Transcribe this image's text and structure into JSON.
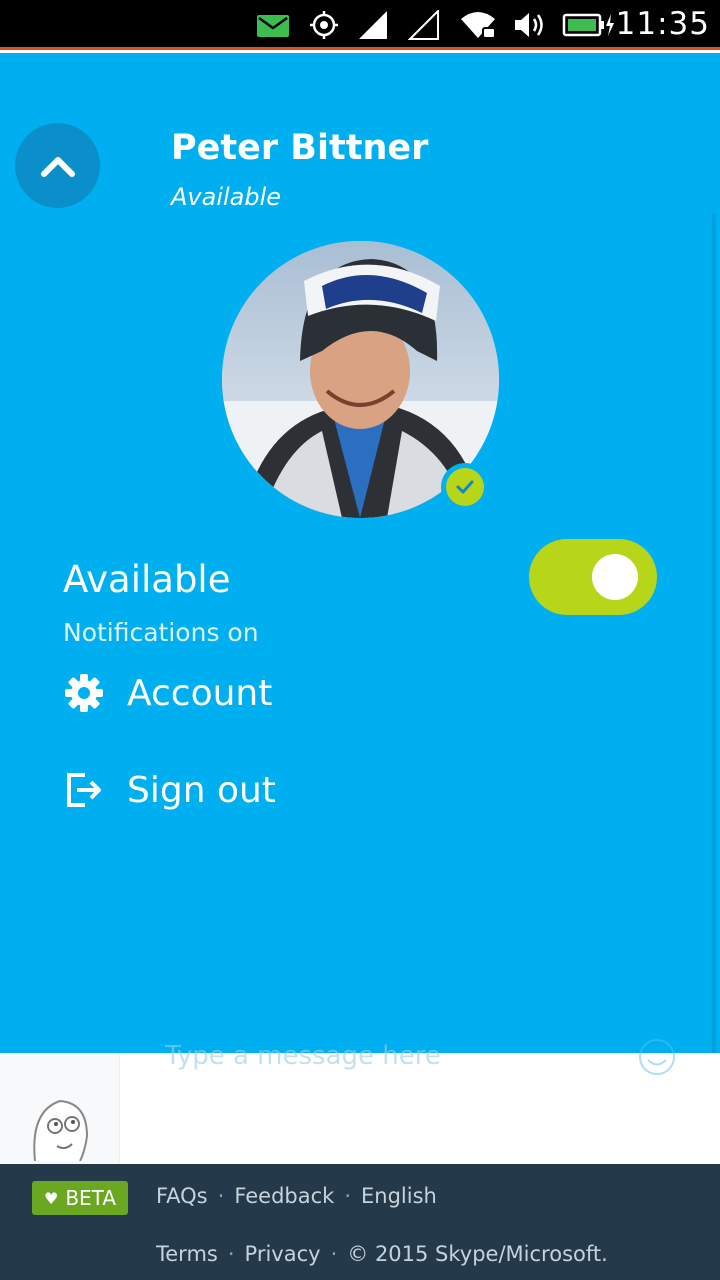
{
  "status_bar": {
    "time": "11:35",
    "icons": [
      "mail-icon",
      "location-icon",
      "signal-icon",
      "signal-empty-icon",
      "wifi-icon",
      "volume-icon",
      "battery-icon"
    ],
    "accent_color": "#d8531c"
  },
  "profile": {
    "name": "Peter Bittner",
    "status": "Available"
  },
  "presence": {
    "title": "Available",
    "subtitle": "Notifications on",
    "toggle_on": true,
    "toggle_color": "#b7d61a"
  },
  "menu": {
    "items": [
      {
        "label": "Account",
        "icon": "gear-icon"
      },
      {
        "label": "Sign out",
        "icon": "sign-out-icon"
      }
    ]
  },
  "chat": {
    "input_placeholder": "Type a message here"
  },
  "footer": {
    "beta_label": "BETA",
    "links_row1": [
      "FAQs",
      "Feedback",
      "English"
    ],
    "links_row2": [
      "Terms",
      "Privacy",
      "© 2015 Skype/Microsoft."
    ]
  },
  "colors": {
    "panel_bg": "#00aff0",
    "footer_bg": "#24394a",
    "beta_bg": "#69a820"
  }
}
